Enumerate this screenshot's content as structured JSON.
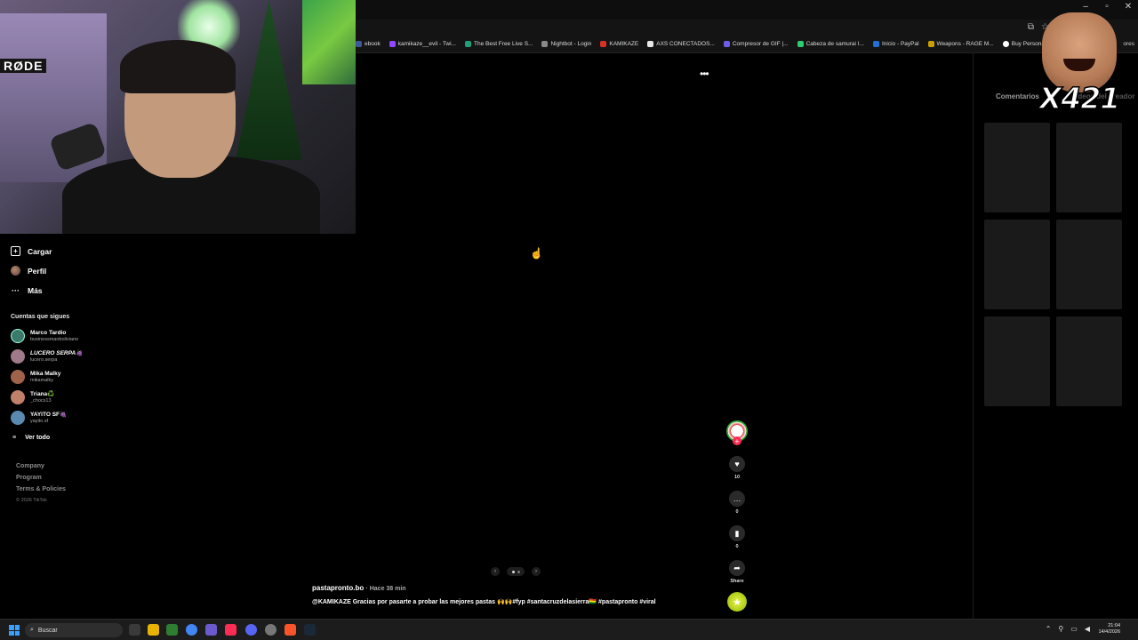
{
  "window": {
    "controls": [
      "–",
      "▫",
      "✕"
    ]
  },
  "bookmarks": [
    {
      "label": "ebook",
      "color": "#3b5998"
    },
    {
      "label": "kamikaze__evil - Twi...",
      "color": "#9146ff"
    },
    {
      "label": "The Best Free Live S...",
      "color": "#1fa07a"
    },
    {
      "label": "Nightbot - Login",
      "color": "#888888"
    },
    {
      "label": "KAMIKAZE",
      "color": "#d93025"
    },
    {
      "label": "AXS CONECTADOS...",
      "color": "#e8e8e8"
    },
    {
      "label": "Compresor de GIF |...",
      "color": "#6c5ce7"
    },
    {
      "label": "Cabeza de samurai I...",
      "color": "#2ecc71"
    },
    {
      "label": "Inicio - PayPal",
      "color": "#1f6fd6"
    },
    {
      "label": "Weapons - RAGE M...",
      "color": "#c8a000"
    },
    {
      "label": "Buy Personalized 11...",
      "color": "#ffffff"
    }
  ],
  "bookmarks_more": "ores",
  "webcam": {
    "brand": "RØDE"
  },
  "meme": {
    "caption": "X421"
  },
  "sidebar": {
    "upload_label": "Cargar",
    "profile_label": "Perfil",
    "more_label": "Más",
    "following_title": "Cuentas que sigues",
    "following": [
      {
        "name": "Marco Tardio",
        "handle": "businessmanboliviano",
        "color": "#3a7a6a"
      },
      {
        "name": "LUCERO SERPA🍇",
        "handle": "lucero.serpa",
        "color": "#a07a8a"
      },
      {
        "name": "Mika Malky",
        "handle": "mikamalky",
        "color": "#a0624a"
      },
      {
        "name": "Triana♻️",
        "handle": "_chocs13",
        "color": "#c0806a"
      },
      {
        "name": "YAYITO SF🍇",
        "handle": "yayito.sf",
        "color": "#5a8ab0"
      }
    ],
    "see_all": "Ver todo",
    "footer": {
      "company": "Company",
      "program": "Program",
      "terms": "Terms & Policies",
      "copyright": "© 2026 TikTok"
    }
  },
  "video": {
    "author": "pastapronto.bo",
    "time": "· Hace 38 min",
    "caption": "@KAMIKAZE Gracias por pasarte a probar las mejores pastas 🙌🙌#fyp #santacruzdelasierra🇧🇴 #pastapronto #viral",
    "likes": "10",
    "comments": "0",
    "saves": "0",
    "share_label": "Share"
  },
  "right_panel": {
    "tab_comments": "Comentarios",
    "tab_creator": "Videos del creador"
  },
  "taskbar": {
    "search_placeholder": "Buscar",
    "time": "21:04",
    "date": "14/4/2026"
  }
}
